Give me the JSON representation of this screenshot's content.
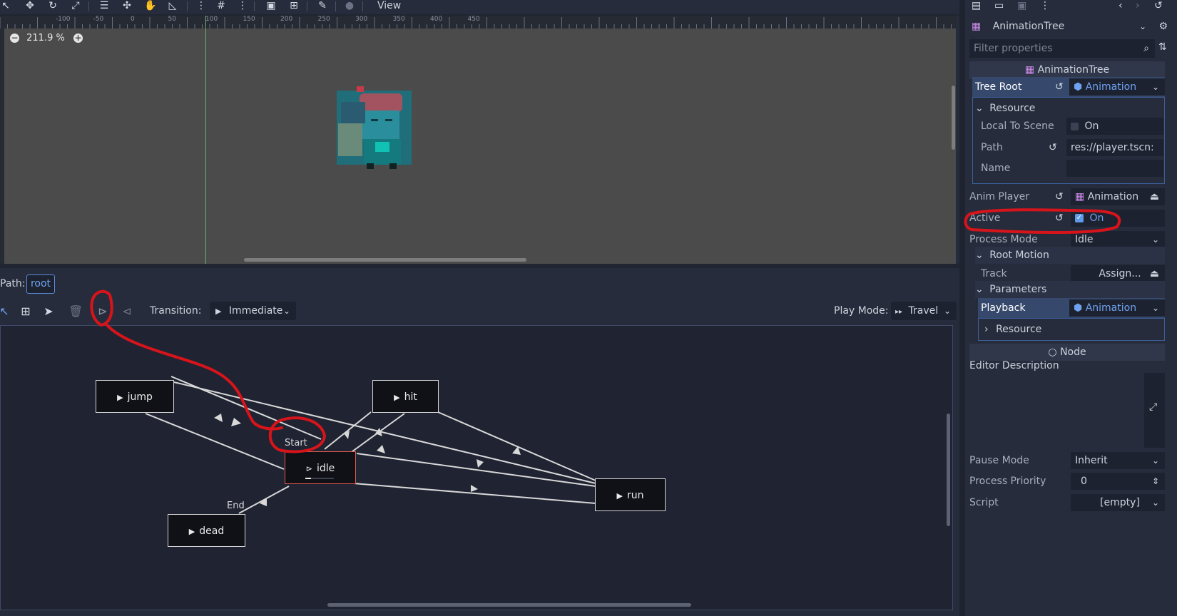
{
  "toolbar": {
    "view_label": "View"
  },
  "viewport": {
    "zoom_label": "211.9 %",
    "ruler_ticks": [
      "-100",
      "-50",
      "0",
      "50",
      "100",
      "150",
      "200",
      "250",
      "300",
      "350",
      "400",
      "450"
    ]
  },
  "animation_panel": {
    "path_label": "Path:",
    "path_value": "root",
    "transition_label": "Transition:",
    "transition_value": "Immediate",
    "play_mode_label": "Play Mode:",
    "play_mode_value": "Travel",
    "nodes": {
      "jump": "jump",
      "hit": "hit",
      "idle": "idle",
      "run": "run",
      "dead": "dead"
    },
    "start_label": "Start",
    "end_label": "End"
  },
  "inspector": {
    "object_name": "AnimationTree",
    "filter_placeholder": "Filter properties",
    "class_header": "AnimationTree",
    "tree_root_label": "Tree Root",
    "tree_root_value": "Animation",
    "resource_section": "Resource",
    "local_to_scene_label": "Local To Scene",
    "local_to_scene_value": "On",
    "path_label": "Path",
    "path_value": "res://player.tscn:",
    "name_label": "Name",
    "anim_player_label": "Anim Player",
    "anim_player_value": "Animation",
    "active_label": "Active",
    "active_value": "On",
    "process_mode_label": "Process Mode",
    "process_mode_value": "Idle",
    "root_motion_section": "Root Motion",
    "track_label": "Track",
    "track_value": "Assign...",
    "parameters_section": "Parameters",
    "playback_label": "Playback",
    "playback_value": "Animation",
    "playback_resource_section": "Resource",
    "node_header": "Node",
    "editor_description_label": "Editor Description",
    "pause_mode_label": "Pause Mode",
    "pause_mode_value": "Inherit",
    "process_priority_label": "Process Priority",
    "process_priority_value": "0",
    "script_label": "Script",
    "script_value": "[empty]"
  },
  "colors": {
    "annotation_red": "#d8141b",
    "accent_blue": "#6ea2f0",
    "idle_border": "#e05a4f"
  }
}
